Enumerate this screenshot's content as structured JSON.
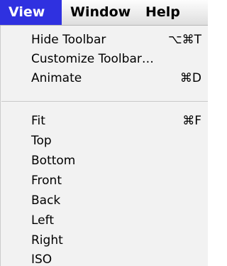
{
  "menubar": {
    "items": [
      {
        "label": "View",
        "active": true
      },
      {
        "label": "Window",
        "active": false
      },
      {
        "label": "Help",
        "active": false
      }
    ]
  },
  "view_menu": {
    "groups": [
      [
        {
          "label": "Hide Toolbar",
          "shortcut": "⌥⌘T"
        },
        {
          "label": "Customize Toolbar…",
          "shortcut": ""
        },
        {
          "label": "Animate",
          "shortcut": "⌘D"
        }
      ],
      [
        {
          "label": "Fit",
          "shortcut": "⌘F"
        },
        {
          "label": "Top",
          "shortcut": ""
        },
        {
          "label": "Bottom",
          "shortcut": ""
        },
        {
          "label": "Front",
          "shortcut": ""
        },
        {
          "label": "Back",
          "shortcut": ""
        },
        {
          "label": "Left",
          "shortcut": ""
        },
        {
          "label": "Right",
          "shortcut": ""
        },
        {
          "label": "ISO",
          "shortcut": ""
        }
      ]
    ]
  },
  "colors": {
    "highlight": "#2f31e0",
    "menu_background": "#f2f2f2",
    "menubar_background": "#ececec"
  }
}
